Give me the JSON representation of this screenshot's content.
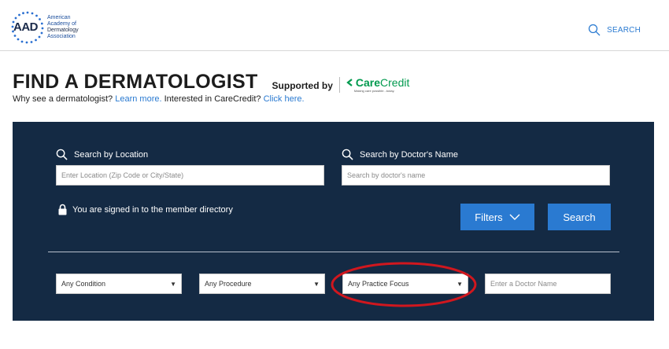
{
  "header": {
    "logo_mark": "AAD",
    "logo_lines": [
      "American",
      "Academy of",
      "Dermatology",
      "Association"
    ],
    "search_label": "SEARCH",
    "search_icon": "search-icon"
  },
  "title": {
    "heading": "FIND A DERMATOLOGIST",
    "supported_by": "Supported by",
    "sponsor_name_part1": "Care",
    "sponsor_name_part2": "Credit",
    "sponsor_tagline": "Making care possible...today."
  },
  "subline": {
    "question": "Why see a dermatologist?",
    "learn_more": "Learn more.",
    "interested": "Interested in CareCredit?",
    "click_here": "Click here."
  },
  "search_panel": {
    "location_label": "Search by Location",
    "location_placeholder": "Enter Location (Zip Code or City/State)",
    "doctor_label": "Search by Doctor's Name",
    "doctor_placeholder": "Search by doctor's name",
    "signed_in_text": "You are signed in to the member directory",
    "filters_label": "Filters",
    "search_label": "Search",
    "filters": {
      "condition": "Any Condition",
      "procedure": "Any Procedure",
      "practice_focus": "Any Practice Focus",
      "doctor_name_placeholder": "Enter a Doctor Name"
    }
  },
  "colors": {
    "panel_bg": "#142a44",
    "accent_blue": "#2a7ad1",
    "carecredit_green": "#009a4e",
    "highlight_red": "#d0171e"
  }
}
